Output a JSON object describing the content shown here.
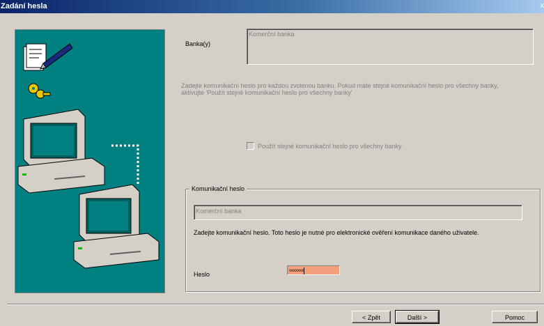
{
  "window": {
    "title": "Zadání hesla",
    "close_glyph": "x"
  },
  "bank": {
    "label": "Banka(y)",
    "list_value": "Komerční banka"
  },
  "instructions": {
    "line1": "Zadejte komunikační heslo pro každou zvolenou banku. Pokud máte stejné komunikační heslo pro všechny banky,",
    "line2": "aktivujte 'Použít stejné komunikační heslo pro všechny banky'"
  },
  "same_password_checkbox": {
    "label": "Použít stejné komunikační heslo pro všechny banky",
    "checked": false
  },
  "comm_group": {
    "legend": "Komunikační heslo",
    "bank_value": "Komerční banka",
    "description": "Zadejte komunikační heslo. Toto heslo je nutné pro elektronické ověření komunikace daného uživatele.",
    "password_label": "Heslo",
    "password_mask": "xxxxxxx"
  },
  "buttons": {
    "back": "< Zpět",
    "next": "Další >",
    "help": "Pomoc"
  },
  "colors": {
    "art_background": "#008080",
    "password_field": "#f4a07c",
    "title_bar": "#0a246a"
  },
  "icons": [
    "document-pen-icon",
    "keys-icon",
    "computer-icon",
    "computer-icon"
  ]
}
